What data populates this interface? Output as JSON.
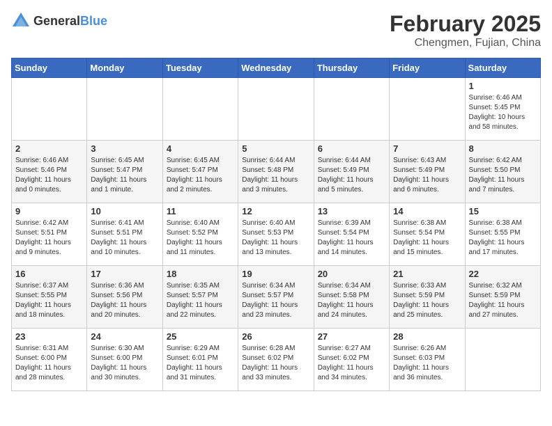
{
  "logo": {
    "text_general": "General",
    "text_blue": "Blue"
  },
  "header": {
    "month_title": "February 2025",
    "location": "Chengmen, Fujian, China"
  },
  "weekdays": [
    "Sunday",
    "Monday",
    "Tuesday",
    "Wednesday",
    "Thursday",
    "Friday",
    "Saturday"
  ],
  "weeks": [
    [
      {
        "day": "",
        "info": ""
      },
      {
        "day": "",
        "info": ""
      },
      {
        "day": "",
        "info": ""
      },
      {
        "day": "",
        "info": ""
      },
      {
        "day": "",
        "info": ""
      },
      {
        "day": "",
        "info": ""
      },
      {
        "day": "1",
        "info": "Sunrise: 6:46 AM\nSunset: 5:45 PM\nDaylight: 10 hours and 58 minutes."
      }
    ],
    [
      {
        "day": "2",
        "info": "Sunrise: 6:46 AM\nSunset: 5:46 PM\nDaylight: 11 hours and 0 minutes."
      },
      {
        "day": "3",
        "info": "Sunrise: 6:45 AM\nSunset: 5:47 PM\nDaylight: 11 hours and 1 minute."
      },
      {
        "day": "4",
        "info": "Sunrise: 6:45 AM\nSunset: 5:47 PM\nDaylight: 11 hours and 2 minutes."
      },
      {
        "day": "5",
        "info": "Sunrise: 6:44 AM\nSunset: 5:48 PM\nDaylight: 11 hours and 3 minutes."
      },
      {
        "day": "6",
        "info": "Sunrise: 6:44 AM\nSunset: 5:49 PM\nDaylight: 11 hours and 5 minutes."
      },
      {
        "day": "7",
        "info": "Sunrise: 6:43 AM\nSunset: 5:49 PM\nDaylight: 11 hours and 6 minutes."
      },
      {
        "day": "8",
        "info": "Sunrise: 6:42 AM\nSunset: 5:50 PM\nDaylight: 11 hours and 7 minutes."
      }
    ],
    [
      {
        "day": "9",
        "info": "Sunrise: 6:42 AM\nSunset: 5:51 PM\nDaylight: 11 hours and 9 minutes."
      },
      {
        "day": "10",
        "info": "Sunrise: 6:41 AM\nSunset: 5:51 PM\nDaylight: 11 hours and 10 minutes."
      },
      {
        "day": "11",
        "info": "Sunrise: 6:40 AM\nSunset: 5:52 PM\nDaylight: 11 hours and 11 minutes."
      },
      {
        "day": "12",
        "info": "Sunrise: 6:40 AM\nSunset: 5:53 PM\nDaylight: 11 hours and 13 minutes."
      },
      {
        "day": "13",
        "info": "Sunrise: 6:39 AM\nSunset: 5:54 PM\nDaylight: 11 hours and 14 minutes."
      },
      {
        "day": "14",
        "info": "Sunrise: 6:38 AM\nSunset: 5:54 PM\nDaylight: 11 hours and 15 minutes."
      },
      {
        "day": "15",
        "info": "Sunrise: 6:38 AM\nSunset: 5:55 PM\nDaylight: 11 hours and 17 minutes."
      }
    ],
    [
      {
        "day": "16",
        "info": "Sunrise: 6:37 AM\nSunset: 5:55 PM\nDaylight: 11 hours and 18 minutes."
      },
      {
        "day": "17",
        "info": "Sunrise: 6:36 AM\nSunset: 5:56 PM\nDaylight: 11 hours and 20 minutes."
      },
      {
        "day": "18",
        "info": "Sunrise: 6:35 AM\nSunset: 5:57 PM\nDaylight: 11 hours and 22 minutes."
      },
      {
        "day": "19",
        "info": "Sunrise: 6:34 AM\nSunset: 5:57 PM\nDaylight: 11 hours and 23 minutes."
      },
      {
        "day": "20",
        "info": "Sunrise: 6:34 AM\nSunset: 5:58 PM\nDaylight: 11 hours and 24 minutes."
      },
      {
        "day": "21",
        "info": "Sunrise: 6:33 AM\nSunset: 5:59 PM\nDaylight: 11 hours and 25 minutes."
      },
      {
        "day": "22",
        "info": "Sunrise: 6:32 AM\nSunset: 5:59 PM\nDaylight: 11 hours and 27 minutes."
      }
    ],
    [
      {
        "day": "23",
        "info": "Sunrise: 6:31 AM\nSunset: 6:00 PM\nDaylight: 11 hours and 28 minutes."
      },
      {
        "day": "24",
        "info": "Sunrise: 6:30 AM\nSunset: 6:00 PM\nDaylight: 11 hours and 30 minutes."
      },
      {
        "day": "25",
        "info": "Sunrise: 6:29 AM\nSunset: 6:01 PM\nDaylight: 11 hours and 31 minutes."
      },
      {
        "day": "26",
        "info": "Sunrise: 6:28 AM\nSunset: 6:02 PM\nDaylight: 11 hours and 33 minutes."
      },
      {
        "day": "27",
        "info": "Sunrise: 6:27 AM\nSunset: 6:02 PM\nDaylight: 11 hours and 34 minutes."
      },
      {
        "day": "28",
        "info": "Sunrise: 6:26 AM\nSunset: 6:03 PM\nDaylight: 11 hours and 36 minutes."
      },
      {
        "day": "",
        "info": ""
      }
    ]
  ]
}
